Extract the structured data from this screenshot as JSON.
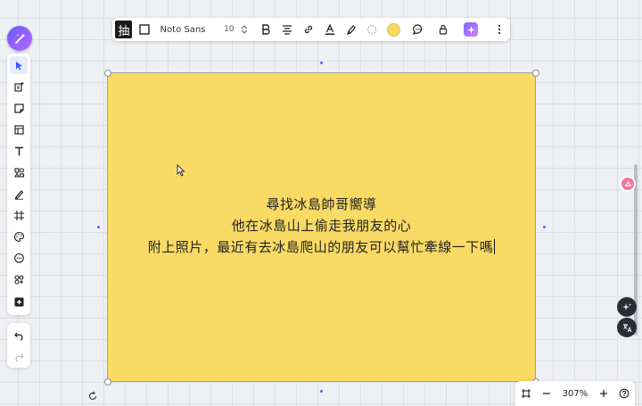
{
  "toolbar": {
    "glyph": "抽",
    "font_name": "Noto Sans",
    "font_size": "10",
    "note_color": "#f9da65",
    "icons": [
      "shape-outline-icon",
      "bold-icon",
      "align-center-icon",
      "link-icon",
      "text-color-icon",
      "highlighter-icon",
      "border-style-icon",
      "color-swatch",
      "comment-icon",
      "lock-icon",
      "ai-sparkle-icon",
      "more-icon"
    ]
  },
  "sticky_note": {
    "lines": [
      "尋找冰島帥哥嚮導",
      "他在冰島山上偷走我朋友的心",
      "附上照片，最近有去冰島爬山的朋友可以幫忙牽線一下嗎"
    ]
  },
  "zoom": {
    "level": "307%"
  },
  "sidebar": {
    "tools": [
      "select-tool",
      "templates",
      "sticky-note",
      "frame-layout",
      "text",
      "shapes",
      "pen",
      "frame",
      "palette",
      "comment",
      "integrations",
      "add-more"
    ]
  }
}
